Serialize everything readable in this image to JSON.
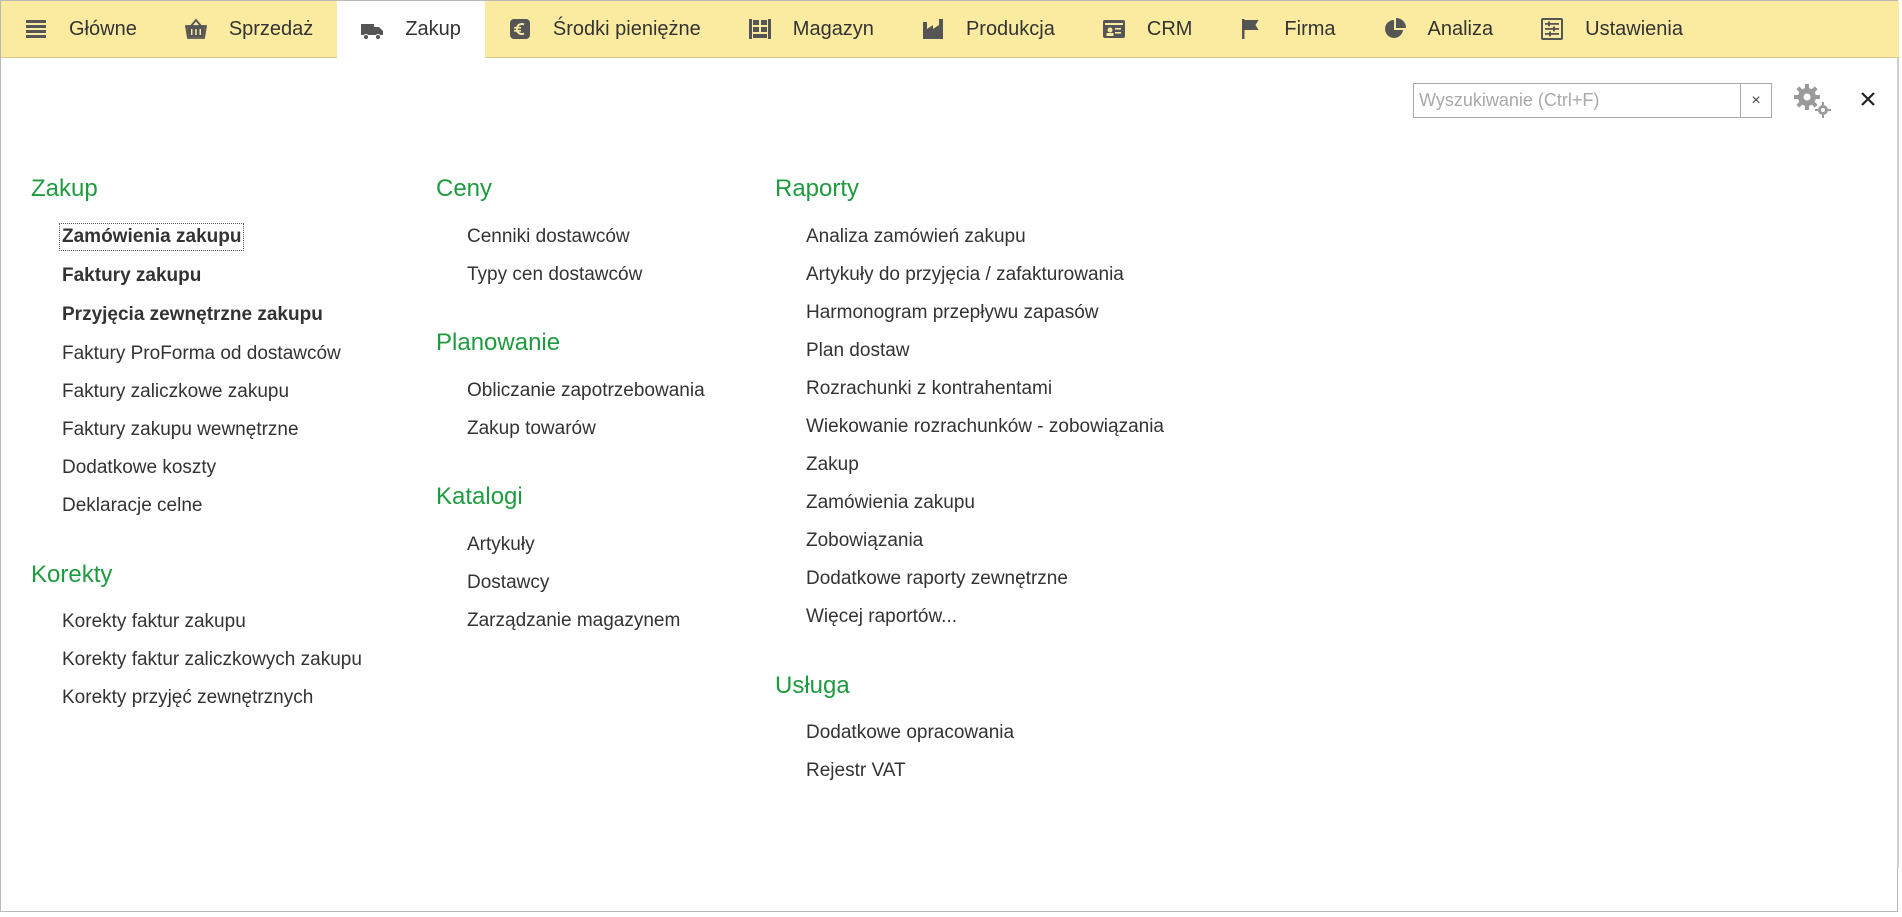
{
  "nav": {
    "items": [
      {
        "label": "Główne",
        "icon": "hamburger-icon"
      },
      {
        "label": "Sprzedaż",
        "icon": "basket-icon"
      },
      {
        "label": "Zakup",
        "icon": "truck-icon",
        "active": true
      },
      {
        "label": "Środki pieniężne",
        "icon": "euro-icon"
      },
      {
        "label": "Magazyn",
        "icon": "warehouse-icon"
      },
      {
        "label": "Produkcja",
        "icon": "factory-icon"
      },
      {
        "label": "CRM",
        "icon": "contact-card-icon"
      },
      {
        "label": "Firma",
        "icon": "flag-icon"
      },
      {
        "label": "Analiza",
        "icon": "pie-chart-icon"
      },
      {
        "label": "Ustawienia",
        "icon": "settings-list-icon"
      }
    ]
  },
  "search": {
    "placeholder": "Wyszukiwanie (Ctrl+F)",
    "value": "",
    "clear": "×"
  },
  "close": "×",
  "colors": {
    "nav_bg": "#faeba0",
    "group_title": "#1f9b3f"
  },
  "sections": {
    "zakup": {
      "title": "Zakup",
      "links": [
        "Zamówienia zakupu",
        "Faktury zakupu",
        "Przyjęcia zewnętrzne zakupu",
        "Faktury ProForma od dostawców",
        "Faktury zaliczkowe zakupu",
        "Faktury zakupu wewnętrzne",
        "Dodatkowe koszty",
        "Deklaracje celne"
      ]
    },
    "korekty": {
      "title": "Korekty",
      "links": [
        "Korekty faktur zakupu",
        "Korekty faktur zaliczkowych zakupu",
        "Korekty przyjęć zewnętrznych"
      ]
    },
    "ceny": {
      "title": "Ceny",
      "links": [
        "Cenniki dostawców",
        "Typy cen dostawców"
      ]
    },
    "planowanie": {
      "title": "Planowanie",
      "links": [
        "Obliczanie zapotrzebowania",
        "Zakup towarów"
      ]
    },
    "katalogi": {
      "title": "Katalogi",
      "links": [
        "Artykuły",
        "Dostawcy",
        "Zarządzanie magazynem"
      ]
    },
    "raporty": {
      "title": "Raporty",
      "links": [
        "Analiza zamówień zakupu",
        "Artykuły do przyjęcia / zafakturowania",
        "Harmonogram przepływu zapasów",
        "Plan dostaw",
        "Rozrachunki z kontrahentami",
        "Wiekowanie rozrachunków - zobowiązania",
        "Zakup",
        "Zamówienia zakupu",
        "Zobowiązania",
        "Dodatkowe raporty zewnętrzne",
        "Więcej raportów..."
      ]
    },
    "usluga": {
      "title": "Usługa",
      "links": [
        "Dodatkowe opracowania",
        "Rejestr VAT"
      ]
    }
  }
}
